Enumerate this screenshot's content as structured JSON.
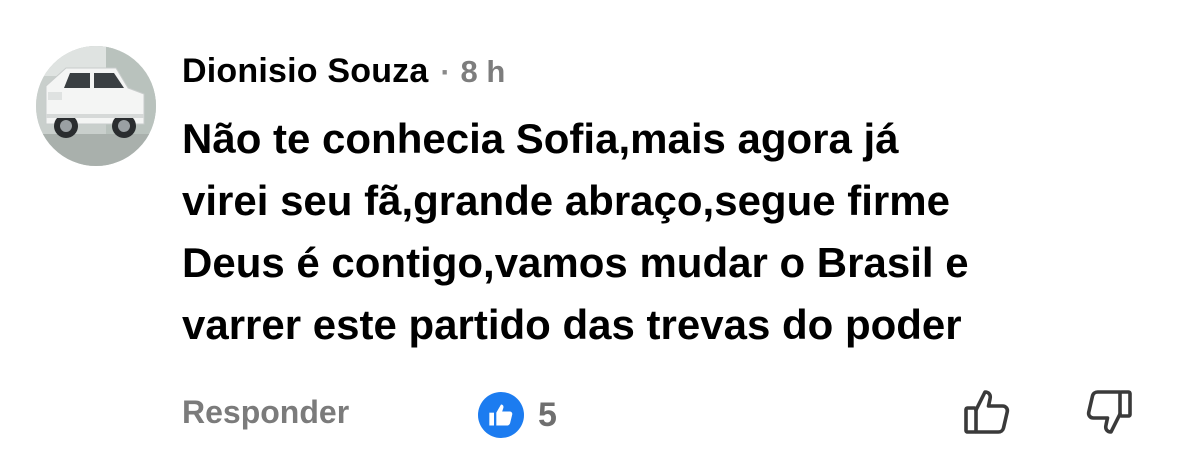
{
  "comment": {
    "author": "Dionisio Souza",
    "separator": "·",
    "time": "8 h",
    "text": "Não te conhecia Sofia,mais agora já\nvirei seu fã,grande abraço,segue firme\nDeus é contigo,vamos mudar o Brasil e\nvarrer este partido das trevas do poder",
    "reply_label": "Responder",
    "like_count": "5"
  },
  "icons": {
    "avatar": "avatar-photo-white-car",
    "like_badge": "thumbs-up-icon",
    "upvote": "thumbs-up-outline-icon",
    "downvote": "thumbs-down-outline-icon"
  },
  "colors": {
    "like_badge": "#1c7cf0",
    "muted_text": "#7b7b7b"
  }
}
